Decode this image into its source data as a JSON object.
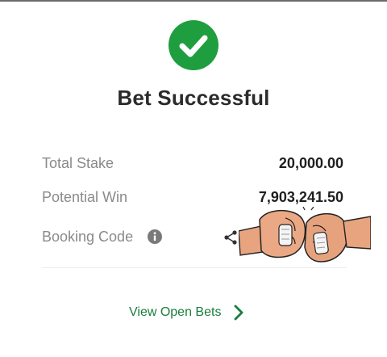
{
  "status": {
    "title": "Bet Successful",
    "icon": "check-circle-icon",
    "accent_color": "#1f9e3f"
  },
  "details": {
    "total_stake_label": "Total Stake",
    "total_stake_value": "20,000.00",
    "potential_win_label": "Potential Win",
    "potential_win_value": "7,903,241.50",
    "booking_code_label": "Booking Code",
    "booking_code_info_icon": "info-icon",
    "share_icon": "share-icon"
  },
  "actions": {
    "view_open_bets_label": "View Open Bets",
    "link_color": "#1a7d3c",
    "chevron_icon": "chevron-right-icon"
  },
  "overlay": {
    "image": "fist-bump-illustration"
  }
}
